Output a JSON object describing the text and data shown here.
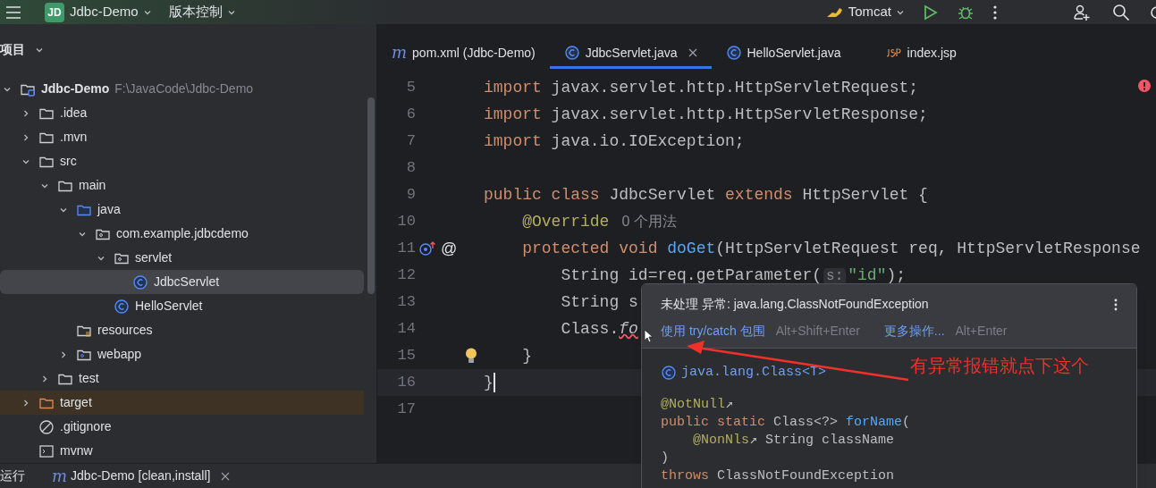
{
  "toolbar": {
    "project_badge": "JD",
    "project": "Jdbc-Demo",
    "vcs": "版本控制",
    "run_config": "Tomcat"
  },
  "project_panel": {
    "title": "项目",
    "tree": [
      {
        "name": "Jdbc-Demo",
        "path": "F:\\JavaCode\\Jdbc-Demo",
        "kind": "module",
        "expanded": true,
        "selected": false,
        "children": [
          {
            "name": ".idea",
            "kind": "folder",
            "expanded": false,
            "selected": false
          },
          {
            "name": ".mvn",
            "kind": "folder",
            "expanded": false,
            "selected": false
          },
          {
            "name": "src",
            "kind": "folder",
            "expanded": true,
            "selected": false,
            "children": [
              {
                "name": "main",
                "kind": "folder",
                "expanded": true,
                "selected": false,
                "children": [
                  {
                    "name": "java",
                    "kind": "source",
                    "expanded": true,
                    "selected": false,
                    "children": [
                      {
                        "name": "com.example.jdbcdemo",
                        "kind": "package",
                        "expanded": true,
                        "selected": false,
                        "children": [
                          {
                            "name": "servlet",
                            "kind": "package",
                            "expanded": true,
                            "selected": false,
                            "children": [
                              {
                                "name": "JdbcServlet",
                                "kind": "class",
                                "selected": true
                              }
                            ]
                          },
                          {
                            "name": "HelloServlet",
                            "kind": "class",
                            "selected": false
                          }
                        ]
                      }
                    ]
                  },
                  {
                    "name": "resources",
                    "kind": "resources",
                    "selected": false
                  },
                  {
                    "name": "webapp",
                    "kind": "web",
                    "expanded": false,
                    "selected": false
                  }
                ]
              },
              {
                "name": "test",
                "kind": "folder",
                "expanded": false,
                "selected": false
              }
            ]
          },
          {
            "name": "target",
            "kind": "excluded",
            "expanded": false,
            "selected": false
          },
          {
            "name": ".gitignore",
            "kind": "ignore",
            "selected": false
          },
          {
            "name": "mvnw",
            "kind": "script",
            "selected": false
          }
        ]
      }
    ]
  },
  "tabs": [
    {
      "label": "pom.xml (Jdbc-Demo)",
      "kind": "maven",
      "icon": "m",
      "selected": false,
      "closable": false
    },
    {
      "label": "JdbcServlet.java",
      "kind": "class",
      "selected": true,
      "closable": true
    },
    {
      "label": "HelloServlet.java",
      "kind": "class",
      "selected": false,
      "closable": false
    },
    {
      "label": "index.jsp",
      "kind": "jsp",
      "selected": false,
      "closable": false
    }
  ],
  "editor": {
    "lines": [
      {
        "number": "5",
        "kind": "plain",
        "tokens": [
          {
            "text": "import",
            "kind": "kw"
          },
          {
            "text": " javax.servlet.http.HttpServletRequest;",
            "kind": "plain"
          }
        ]
      },
      {
        "number": "6",
        "kind": "plain",
        "tokens": [
          {
            "text": "import",
            "kind": "kw"
          },
          {
            "text": " javax.servlet.http.HttpServletResponse;",
            "kind": "plain"
          }
        ]
      },
      {
        "number": "7",
        "kind": "plain",
        "tokens": [
          {
            "text": "import",
            "kind": "kw"
          },
          {
            "text": " java.io.IOException;",
            "kind": "plain"
          }
        ]
      },
      {
        "number": "8",
        "kind": "plain"
      },
      {
        "number": "9",
        "kind": "plain",
        "tokens": [
          {
            "text": "public class ",
            "kind": "kw"
          },
          {
            "text": "JdbcServlet ",
            "kind": "plain"
          },
          {
            "text": "extends ",
            "kind": "kw"
          },
          {
            "text": "HttpServlet {",
            "kind": "plain"
          }
        ]
      },
      {
        "number": "10",
        "kind": "plain",
        "tokens": [
          {
            "text": "    @Override",
            "kind": "ann"
          },
          {
            "text": "0 个用法",
            "kind": "usage"
          }
        ]
      },
      {
        "number": "11",
        "kind": "override",
        "gutter_text": "@",
        "tokens": [
          {
            "text": "    protected void ",
            "kind": "kw"
          },
          {
            "text": "doGet",
            "kind": "fn"
          },
          {
            "text": "(HttpServletRequest req, HttpServletResponse",
            "kind": "plain"
          }
        ]
      },
      {
        "number": "12",
        "kind": "plain",
        "tokens": [
          {
            "text": "        String id=req.getParameter(",
            "kind": "plain"
          },
          {
            "text": "s:",
            "kind": "hint"
          },
          {
            "text": "\"id\"",
            "kind": "str"
          },
          {
            "text": ");",
            "kind": "plain"
          }
        ]
      },
      {
        "number": "13",
        "kind": "plain",
        "tokens": [
          {
            "text": "        String s",
            "kind": "plain"
          }
        ]
      },
      {
        "number": "14",
        "kind": "plain",
        "tokens": [
          {
            "text": "        Class.",
            "kind": "plain"
          },
          {
            "text": "fo",
            "kind": "error"
          }
        ]
      },
      {
        "number": "15",
        "kind": "bulb",
        "tokens": [
          {
            "text": "    }",
            "kind": "plain"
          }
        ]
      },
      {
        "number": "16",
        "kind": "plain",
        "current": true,
        "tokens": [
          {
            "text": "}",
            "kind": "plain"
          }
        ]
      },
      {
        "number": "17",
        "kind": "plain"
      }
    ]
  },
  "popup": {
    "title": "未处理 异常: java.lang.ClassNotFoundException",
    "actions": [
      {
        "label": "使用 try/catch 包围",
        "shortcut": "Alt+Shift+Enter"
      },
      {
        "label": "更多操作...",
        "shortcut": "Alt+Enter"
      }
    ],
    "signature": "java.lang.Class<T>",
    "doc_lines": [
      [
        {
          "text": "@NotNull",
          "kind": "ann"
        },
        {
          "text": "↗",
          "kind": "plain"
        }
      ],
      [
        {
          "text": "public static ",
          "kind": "kw"
        },
        {
          "text": "Class<?> ",
          "kind": "plain"
        },
        {
          "text": "forName",
          "kind": "fn"
        },
        {
          "text": "(",
          "kind": "plain"
        }
      ],
      [
        {
          "text": "    @NonNls",
          "kind": "ann"
        },
        {
          "text": "↗ String className",
          "kind": "plain"
        }
      ],
      [
        {
          "text": ")",
          "kind": "plain"
        }
      ],
      [
        {
          "text": "throws ",
          "kind": "kw"
        },
        {
          "text": "ClassNotFoundException",
          "kind": "plain"
        }
      ]
    ]
  },
  "annotation": "有异常报错就点下这个",
  "run_bar": {
    "title": "运行",
    "icon": "m",
    "tab": "Jdbc-Demo [clean,install]"
  }
}
